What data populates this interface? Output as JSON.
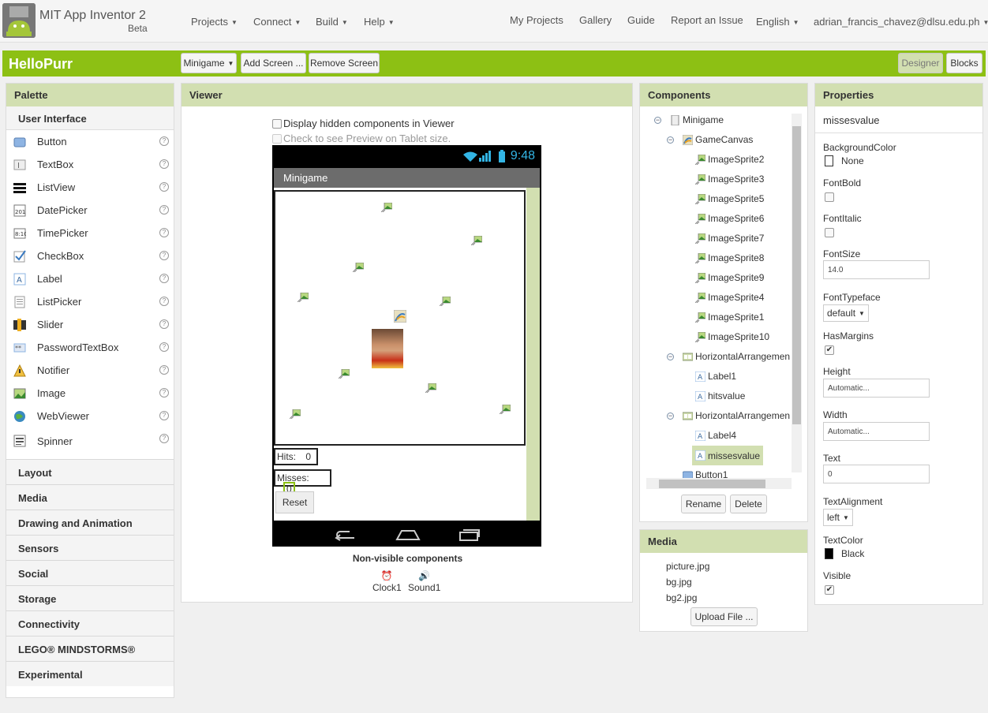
{
  "app": {
    "title": "MIT App Inventor 2",
    "subtitle": "Beta"
  },
  "topnav": {
    "left": [
      "Projects",
      "Connect",
      "Build",
      "Help"
    ],
    "right": {
      "my_projects": "My Projects",
      "gallery": "Gallery",
      "guide": "Guide",
      "report": "Report an Issue",
      "language": "English",
      "user": "adrian_francis_chavez@dlsu.edu.ph"
    }
  },
  "project": {
    "name": "HelloPurr",
    "screen": "Minigame",
    "add_screen": "Add Screen ...",
    "remove_screen": "Remove Screen",
    "designer": "Designer",
    "blocks": "Blocks"
  },
  "palette": {
    "title": "Palette",
    "section": "User Interface",
    "items": [
      {
        "label": "Button",
        "icon": "button-icon"
      },
      {
        "label": "TextBox",
        "icon": "textbox-icon"
      },
      {
        "label": "ListView",
        "icon": "listview-icon"
      },
      {
        "label": "DatePicker",
        "icon": "datepicker-icon"
      },
      {
        "label": "TimePicker",
        "icon": "timepicker-icon"
      },
      {
        "label": "CheckBox",
        "icon": "checkbox-icon"
      },
      {
        "label": "Label",
        "icon": "label-icon"
      },
      {
        "label": "ListPicker",
        "icon": "listpicker-icon"
      },
      {
        "label": "Slider",
        "icon": "slider-icon"
      },
      {
        "label": "PasswordTextBox",
        "icon": "password-icon"
      },
      {
        "label": "Notifier",
        "icon": "notifier-icon"
      },
      {
        "label": "Image",
        "icon": "image-icon"
      },
      {
        "label": "WebViewer",
        "icon": "webviewer-icon"
      },
      {
        "label": "Spinner",
        "icon": "spinner-icon"
      }
    ],
    "categories": [
      "Layout",
      "Media",
      "Drawing and Animation",
      "Sensors",
      "Social",
      "Storage",
      "Connectivity",
      "LEGO® MINDSTORMS®",
      "Experimental"
    ]
  },
  "viewer": {
    "title": "Viewer",
    "show_hidden": "Display hidden components in Viewer",
    "tablet": "Check to see Preview on Tablet size.",
    "time": "9:48",
    "screen_title": "Minigame",
    "hits_label": "Hits:",
    "hits_value": "0",
    "misses_label": "Misses:",
    "misses_value": "0",
    "reset": "Reset",
    "nonvisible_title": "Non-visible components",
    "nonvisible": [
      "Clock1",
      "Sound1"
    ]
  },
  "components": {
    "title": "Components",
    "tree": [
      "Minigame",
      "GameCanvas",
      "ImageSprite2",
      "ImageSprite3",
      "ImageSprite5",
      "ImageSprite6",
      "ImageSprite7",
      "ImageSprite8",
      "ImageSprite9",
      "ImageSprite4",
      "ImageSprite1",
      "ImageSprite10",
      "HorizontalArrangemen",
      "Label1",
      "hitsvalue",
      "HorizontalArrangemen",
      "Label4",
      "missesvalue",
      "Button1"
    ],
    "rename": "Rename",
    "delete": "Delete"
  },
  "media": {
    "title": "Media",
    "files": [
      "picture.jpg",
      "bg.jpg",
      "bg2.jpg"
    ],
    "upload": "Upload File ..."
  },
  "properties": {
    "title": "Properties",
    "component": "missesvalue",
    "background_color": {
      "label": "BackgroundColor",
      "value": "None"
    },
    "font_bold": {
      "label": "FontBold"
    },
    "font_italic": {
      "label": "FontItalic"
    },
    "font_size": {
      "label": "FontSize",
      "value": "14.0"
    },
    "font_typeface": {
      "label": "FontTypeface",
      "value": "default"
    },
    "has_margins": {
      "label": "HasMargins"
    },
    "height": {
      "label": "Height",
      "value": "Automatic..."
    },
    "width": {
      "label": "Width",
      "value": "Automatic..."
    },
    "text": {
      "label": "Text",
      "value": "0"
    },
    "text_alignment": {
      "label": "TextAlignment",
      "value": "left"
    },
    "text_color": {
      "label": "TextColor",
      "value": "Black"
    },
    "visible": {
      "label": "Visible"
    }
  },
  "colors": {
    "accent": "#8dc014",
    "header": "#d2dfb1"
  }
}
